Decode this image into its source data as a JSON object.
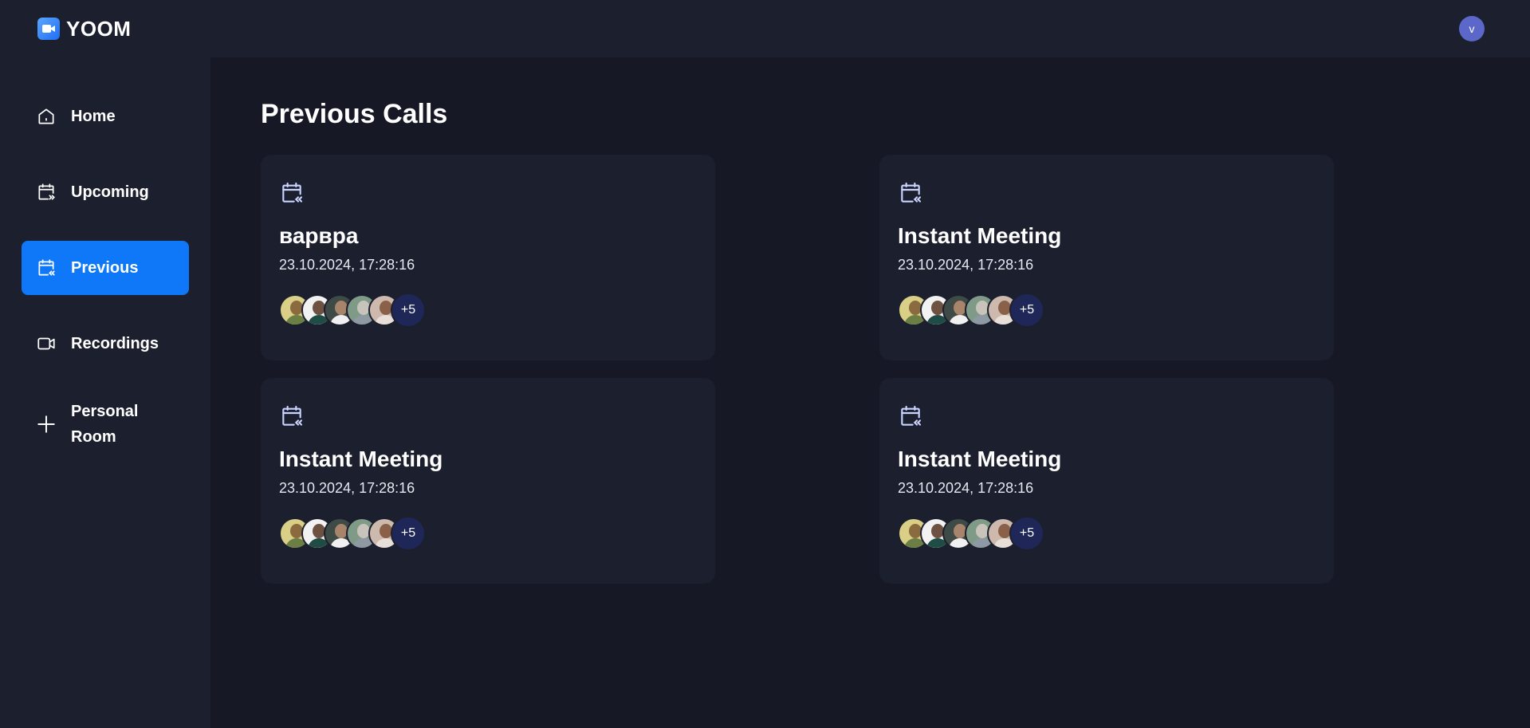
{
  "app": {
    "name": "YOOM"
  },
  "user": {
    "initial": "v"
  },
  "sidebar": {
    "items": [
      {
        "label": "Home",
        "icon": "home-icon"
      },
      {
        "label": "Upcoming",
        "icon": "calendar-upcoming-icon"
      },
      {
        "label": "Previous",
        "icon": "calendar-previous-icon",
        "active": true
      },
      {
        "label": "Recordings",
        "icon": "video-icon"
      },
      {
        "label": "Personal Room",
        "icon": "plus-icon"
      }
    ]
  },
  "main": {
    "title": "Previous Calls",
    "cards": [
      {
        "title": "варвра",
        "date": "23.10.2024, 17:28:16",
        "more": "+5"
      },
      {
        "title": "Instant Meeting",
        "date": "23.10.2024, 17:28:16",
        "more": "+5"
      },
      {
        "title": "Instant Meeting",
        "date": "23.10.2024, 17:28:16",
        "more": "+5"
      },
      {
        "title": "Instant Meeting",
        "date": "23.10.2024, 17:28:16",
        "more": "+5"
      }
    ]
  },
  "colors": {
    "accent": "#0e78f9",
    "panel": "#1c1f2e",
    "background": "#161925"
  }
}
